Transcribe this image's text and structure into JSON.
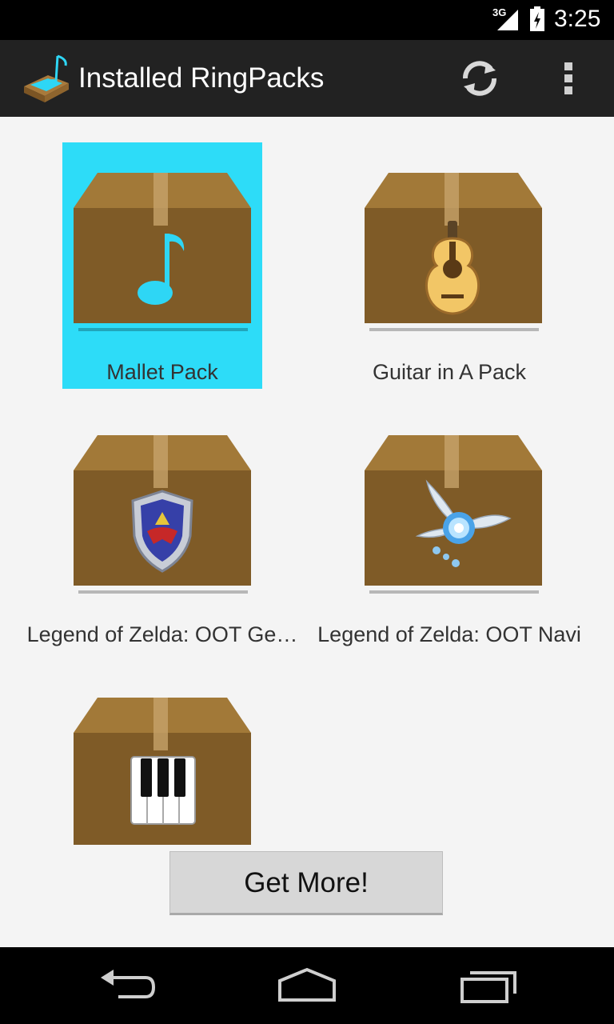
{
  "status_bar": {
    "network": "3G",
    "time": "3:25"
  },
  "action_bar": {
    "title": "Installed RingPacks",
    "icons": [
      "ringpacks-app-icon",
      "refresh-icon",
      "overflow-menu-icon"
    ]
  },
  "packs": [
    {
      "label": "Mallet Pack",
      "icon": "music-note-icon",
      "selected": true
    },
    {
      "label": "Guitar in A Pack",
      "icon": "guitar-icon",
      "selected": false
    },
    {
      "label": "Legend of Zelda: OOT Ge…",
      "icon": "hylian-shield-icon",
      "selected": false
    },
    {
      "label": "Legend of Zelda: OOT Navi",
      "icon": "fairy-icon",
      "selected": false
    },
    {
      "label": "",
      "icon": "piano-keys-icon",
      "selected": false
    }
  ],
  "get_more_button": {
    "label": "Get More!"
  },
  "nav_bar": {
    "icons": [
      "back-icon",
      "home-icon",
      "recent-apps-icon"
    ]
  },
  "colors": {
    "selected_highlight": "#2ddcf8",
    "action_bar": "#222222",
    "box_brown": "#7f5b27"
  }
}
